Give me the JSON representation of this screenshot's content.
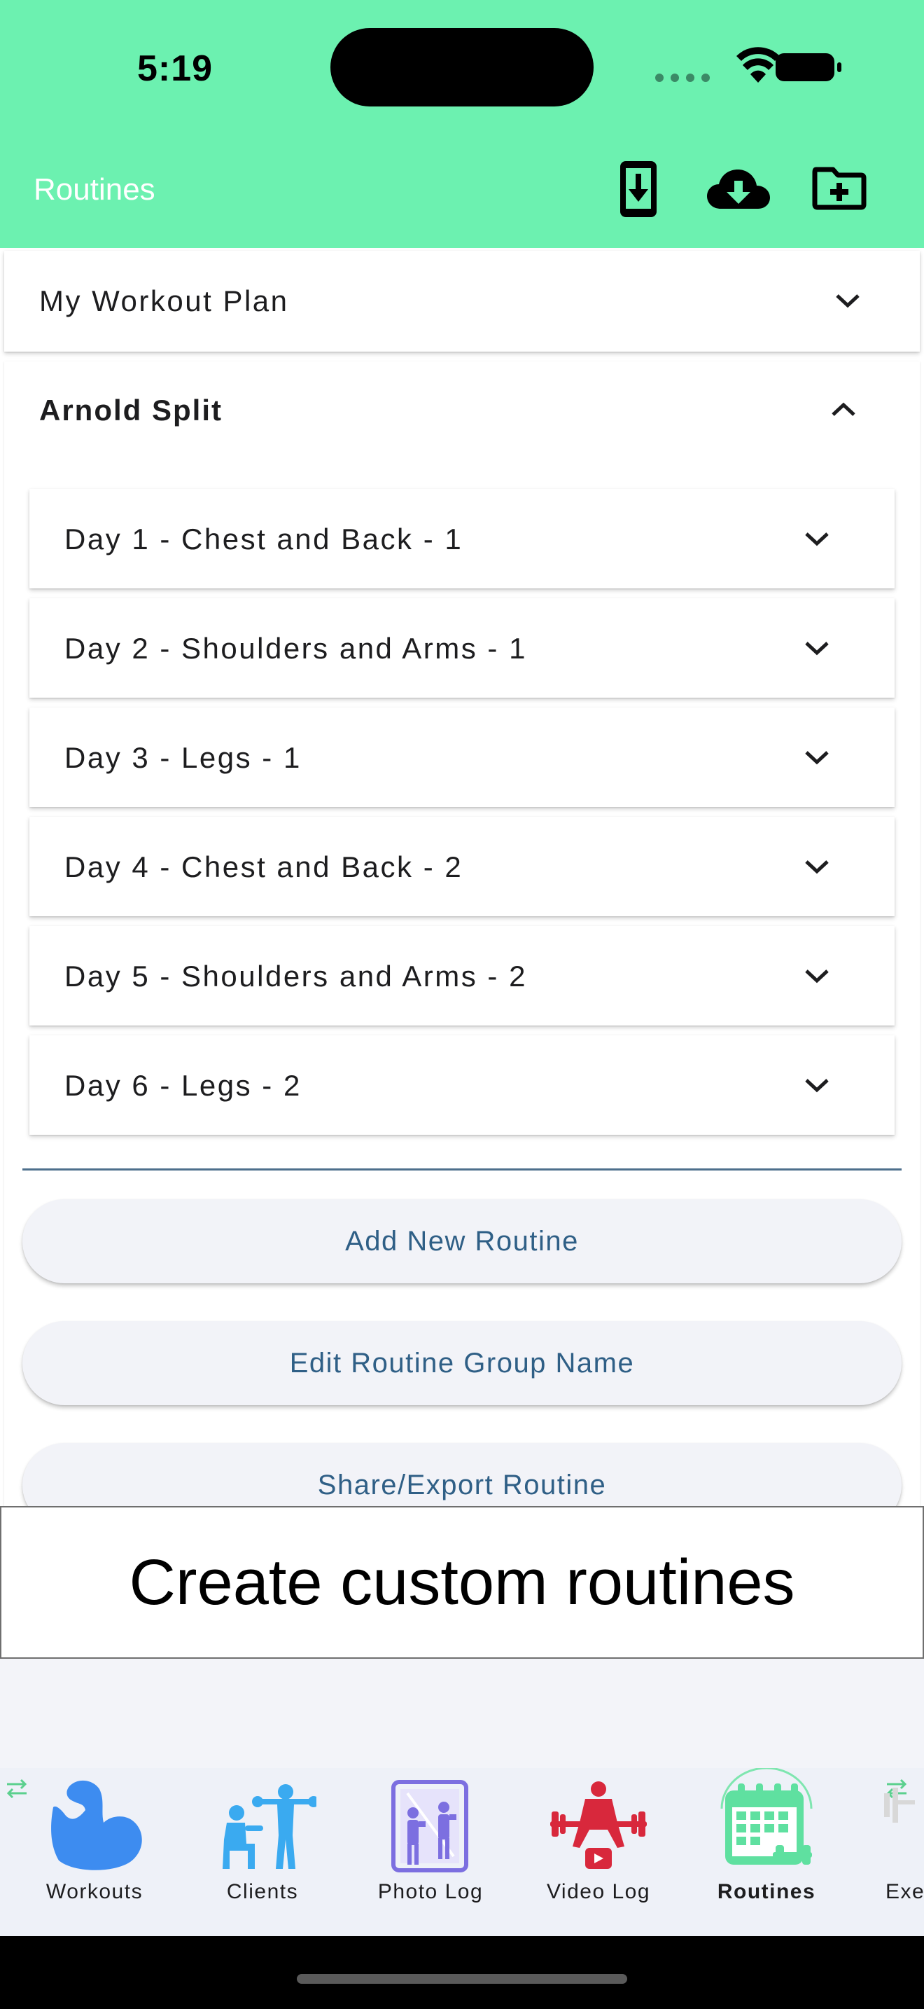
{
  "status_bar": {
    "time": "5:19"
  },
  "app_bar": {
    "title": "Routines",
    "icons": [
      "phone-download-icon",
      "cloud-download-icon",
      "folder-add-icon"
    ]
  },
  "routine_groups": [
    {
      "name": "My Workout Plan",
      "expanded": false
    },
    {
      "name": "Arnold Split",
      "expanded": true
    }
  ],
  "routines": [
    "Day 1 - Chest and Back - 1",
    "Day 2 - Shoulders and Arms - 1",
    "Day 3 - Legs - 1",
    "Day 4 - Chest and Back - 2",
    "Day 5 - Shoulders and Arms - 2",
    "Day 6 - Legs - 2"
  ],
  "actions": {
    "add_routine": "Add New Routine",
    "edit_group_name": "Edit Routine Group Name",
    "share_export": "Share/Export Routine"
  },
  "caption": "Create custom routines",
  "bottom_nav": {
    "items": [
      {
        "label": "Workouts",
        "icon": "flexed-bicep-icon"
      },
      {
        "label": "Clients",
        "icon": "trainer-client-icon"
      },
      {
        "label": "Photo Log",
        "icon": "mirror-photo-icon"
      },
      {
        "label": "Video Log",
        "icon": "weightlifter-video-icon"
      },
      {
        "label": "Routines",
        "icon": "calendar-dumbbell-icon",
        "active": true
      },
      {
        "label": "Exe",
        "icon": "exercise-icon"
      }
    ]
  },
  "colors": {
    "header": "#6cf1b0",
    "accent_text": "#2f5f86",
    "workouts_icon": "#3d8cf0",
    "clients_icon": "#3aaaf0",
    "photo_icon": "#7c6fe0",
    "video_icon": "#d8283c",
    "routines_icon": "#5fe0a0"
  }
}
